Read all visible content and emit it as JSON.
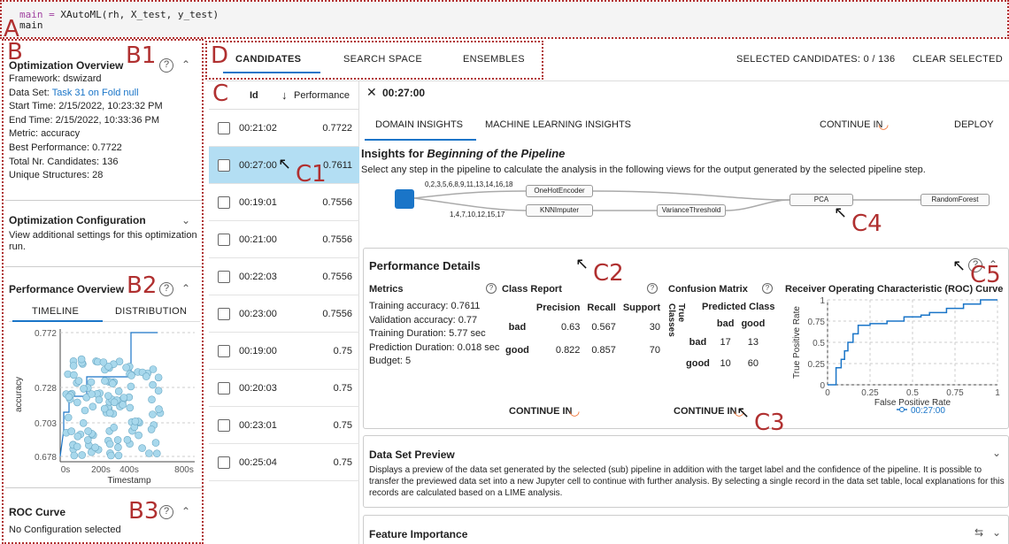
{
  "code": {
    "line1_var": "main",
    "line1_eq": " = ",
    "line1_call": "XAutoML(rh, X_test, y_test)",
    "line2": "main"
  },
  "labels": {
    "A": "A",
    "B": "B",
    "B1": "B1",
    "B2": "B2",
    "B3": "B3",
    "C": "C",
    "C1": "C1",
    "C2": "C2",
    "C3": "C3",
    "C4": "C4",
    "C5": "C5",
    "D": "D"
  },
  "sidebar": {
    "overview": {
      "title": "Optimization Overview",
      "framework_label": "Framework:",
      "framework_value": "dswizard",
      "dataset_label": "Data Set:",
      "dataset_value": "Task 31 on Fold null",
      "start_label": "Start Time:",
      "start_value": "2/15/2022, 10:23:32 PM",
      "end_label": "End Time:",
      "end_value": "2/15/2022, 10:33:36 PM",
      "metric_label": "Metric:",
      "metric_value": "accuracy",
      "best_label": "Best Performance:",
      "best_value": "0.7722",
      "total_label": "Total Nr. Candidates:",
      "total_value": "136",
      "unique_label": "Unique Structures:",
      "unique_value": "28"
    },
    "config": {
      "title": "Optimization Configuration",
      "text": "View additional settings for this optimization run."
    },
    "perf": {
      "title": "Performance Overview",
      "tab_timeline": "TIMELINE",
      "tab_distribution": "DISTRIBUTION",
      "ylabel": "accuracy",
      "xlabel": "Timestamp",
      "yticks": [
        "0.772",
        "0.728",
        "0.703",
        "0.678"
      ],
      "xticks": [
        "0s",
        "200s",
        "400s",
        "800s"
      ]
    },
    "roc": {
      "title": "ROC Curve",
      "text": "No Configuration selected"
    }
  },
  "topbar": {
    "tabs": [
      "CANDIDATES",
      "SEARCH SPACE",
      "ENSEMBLES"
    ],
    "selected": "SELECTED CANDIDATES: 0 / 136",
    "clear": "CLEAR SELECTED"
  },
  "candidates": {
    "col_id": "Id",
    "col_perf": "Performance",
    "sort_icon": "arrow-down-icon",
    "rows": [
      {
        "id": "00:21:02",
        "perf": "0.7722"
      },
      {
        "id": "00:27:00",
        "perf": "0.7611"
      },
      {
        "id": "00:19:01",
        "perf": "0.7556"
      },
      {
        "id": "00:21:00",
        "perf": "0.7556"
      },
      {
        "id": "00:22:03",
        "perf": "0.7556"
      },
      {
        "id": "00:23:00",
        "perf": "0.7556"
      },
      {
        "id": "00:19:00",
        "perf": "0.75"
      },
      {
        "id": "00:20:03",
        "perf": "0.75"
      },
      {
        "id": "00:23:01",
        "perf": "0.75"
      },
      {
        "id": "00:25:04",
        "perf": "0.75"
      }
    ]
  },
  "detail": {
    "title": "00:27:00",
    "tabs": [
      "DOMAIN INSIGHTS",
      "MACHINE LEARNING INSIGHTS"
    ],
    "continue_in": "CONTINUE IN",
    "deploy": "DEPLOY",
    "insights_prefix": "Insights for ",
    "insights_em": "Beginning of the Pipeline",
    "insights_text": "Select any step in the pipeline to calculate the analysis in the following views for the output generated by the selected pipeline step.",
    "pipeline": {
      "nodes": [
        "OneHotEncoder",
        "KNNImputer",
        "VarianceThreshold",
        "PCA",
        "RandomForest"
      ],
      "edge_top": "0,2,3,5,6,8,9,11,13,14,16,18",
      "edge_bottom": "1,4,7,10,12,15,17"
    },
    "perf": {
      "title": "Performance Details",
      "metrics_title": "Metrics",
      "metrics": [
        {
          "label": "Training accuracy:",
          "value": "0.7611"
        },
        {
          "label": "Validation accuracy:",
          "value": "0.77"
        },
        {
          "label": "Training Duration:",
          "value": "5.77 sec"
        },
        {
          "label": "Prediction Duration:",
          "value": "0.018 sec"
        },
        {
          "label": "Budget:",
          "value": "5"
        }
      ],
      "class_report_title": "Class Report",
      "class_report_headers": [
        "Precision",
        "Recall",
        "Support"
      ],
      "class_report_rows": [
        {
          "cls": "bad",
          "p": "0.63",
          "r": "0.567",
          "s": "30"
        },
        {
          "cls": "good",
          "p": "0.822",
          "r": "0.857",
          "s": "70"
        }
      ],
      "confusion_title": "Confusion Matrix",
      "predicted_class": "Predicted Class",
      "true_classes": "True Classes",
      "cm_cols": [
        "bad",
        "good"
      ],
      "cm_rows": [
        {
          "cls": "bad",
          "v1": "17",
          "v2": "13"
        },
        {
          "cls": "good",
          "v1": "10",
          "v2": "60"
        }
      ],
      "roc_title": "Receiver Operating Characteristic (ROC) Curve",
      "roc_ylabel": "True Positive Rate",
      "roc_xlabel": "False Positive Rate",
      "roc_yticks": [
        "1",
        "0.75",
        "0.5",
        "0.25",
        "0"
      ],
      "roc_xticks": [
        "0",
        "0.25",
        "0.5",
        "0.75",
        "1"
      ],
      "roc_legend": "00:27:00"
    },
    "preview": {
      "title": "Data Set Preview",
      "text": "Displays a preview of the data set generated by the selected (sub) pipeline in addition with the target label and the confidence of the pipeline. It is possible to transfer the previewed data set into a new Jupyter cell to continue with further analysis. By selecting a single record in the data set table, local explanations for this records are calculated based on a LIME analysis."
    },
    "feature": {
      "title": "Feature Importance"
    }
  },
  "colors": {
    "accent": "#1a75c8",
    "selected_row": "#b3def3",
    "annotation": "#b03030",
    "scatter_fill": "#a8d8ec"
  }
}
